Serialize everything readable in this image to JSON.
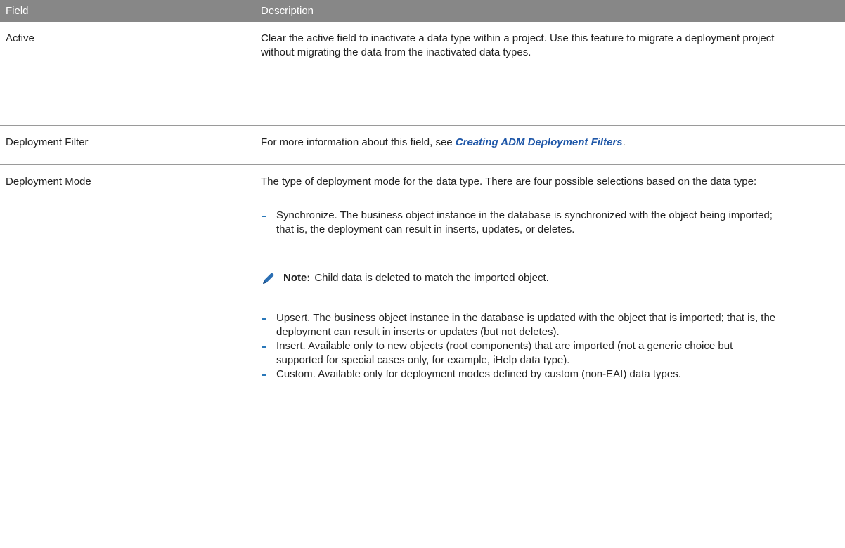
{
  "header": {
    "field": "Field",
    "description": "Description"
  },
  "rows": [
    {
      "field": "Active",
      "description": "Clear the active field to inactivate a data type within a project. Use this feature to migrate a deployment project without migrating the data from the inactivated data types."
    },
    {
      "field": "Deployment Filter",
      "prefix": "For more information about this field, see ",
      "link": "Creating ADM Deployment Filters",
      "suffix": "."
    },
    {
      "field": "Deployment Mode",
      "intro": "The type of deployment mode for the data type. There are four possible selections based on the data type:",
      "items": [
        "Synchronize. The business object instance in the database is synchronized with the object being imported; that is, the deployment can result in inserts, updates, or deletes.",
        "Upsert. The business object instance in the database is updated with the object that is imported; that is, the deployment can result in inserts or updates (but not deletes).",
        "Insert. Available only to new objects (root components) that are imported (not a generic choice but supported for special cases only, for example, iHelp data type).",
        "Custom. Available only for deployment modes defined by custom (non-EAI) data types."
      ],
      "note": {
        "label": "Note:",
        "text": "Child data is deleted to match the imported object.",
        "icon": "pencil-icon"
      }
    }
  ],
  "colors": {
    "header_bg": "#878787",
    "link": "#1f57a8",
    "bullet": "#2a78b9",
    "note_icon": "#2a6eb3"
  }
}
